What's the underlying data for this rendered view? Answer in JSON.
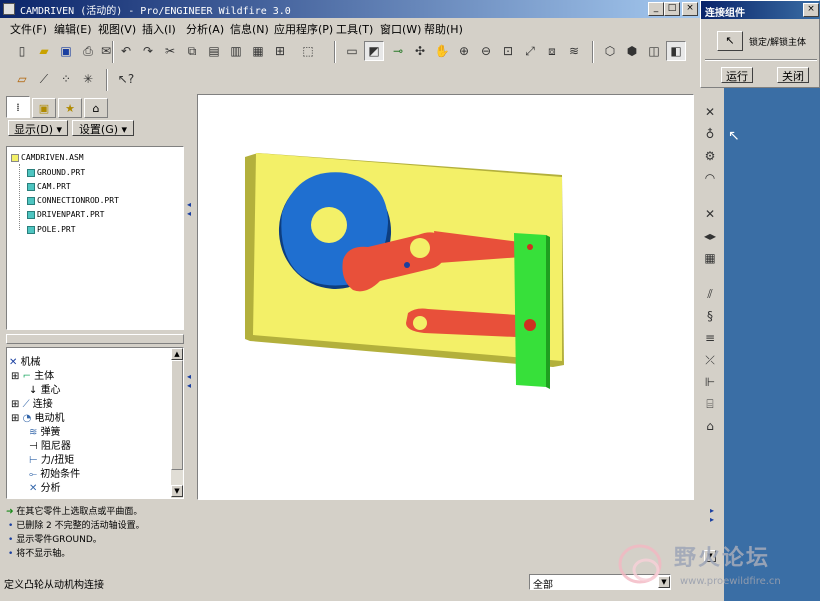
{
  "titlebar": {
    "title": "CAMDRIVEN (活动的) - Pro/ENGINEER Wildfire 3.0",
    "min": "_",
    "max": "□",
    "close": "×"
  },
  "menu": [
    "文件(F)",
    "编辑(E)",
    "视图(V)",
    "插入(I)",
    "分析(A)",
    "信息(N)",
    "应用程序(P)",
    "工具(T)",
    "窗口(W)",
    "帮助(H)"
  ],
  "nav": {
    "show_label": "显示(D) ▾",
    "settings_label": "设置(G) ▾"
  },
  "model_tree": {
    "root": "CAMDRIVEN.ASM",
    "parts": [
      "GROUND.PRT",
      "CAM.PRT",
      "CONNECTIONROD.PRT",
      "DRIVENPART.PRT",
      "POLE.PRT"
    ]
  },
  "mechanism_tree": {
    "root": "机械",
    "items": [
      "主体",
      "重心",
      "连接",
      "电动机",
      "弹簧",
      "阻尼器",
      "力/扭矩",
      "初始条件",
      "分析"
    ]
  },
  "messages": [
    "在其它零件上选取点或平曲面。",
    "已删除 2 不完整的活动轴设置。",
    "显示零件GROUND。",
    "将不显示轴。"
  ],
  "status": {
    "text": "定义凸轮从动机构连接",
    "filter": "全部"
  },
  "dialog": {
    "title": "连接组件",
    "lock_label": "锁定/解锁主体",
    "run_label": "运行",
    "close_label": "关闭"
  },
  "watermark": {
    "title": "野火论坛",
    "url": "www.proewildfire.cn"
  },
  "colors": {
    "base": "#f3f068",
    "cam": "#1f6fd0",
    "rod": "#e8503a",
    "pole": "#37e03a",
    "title_bar": "#0a246a",
    "desktop": "#3a6ea5"
  }
}
